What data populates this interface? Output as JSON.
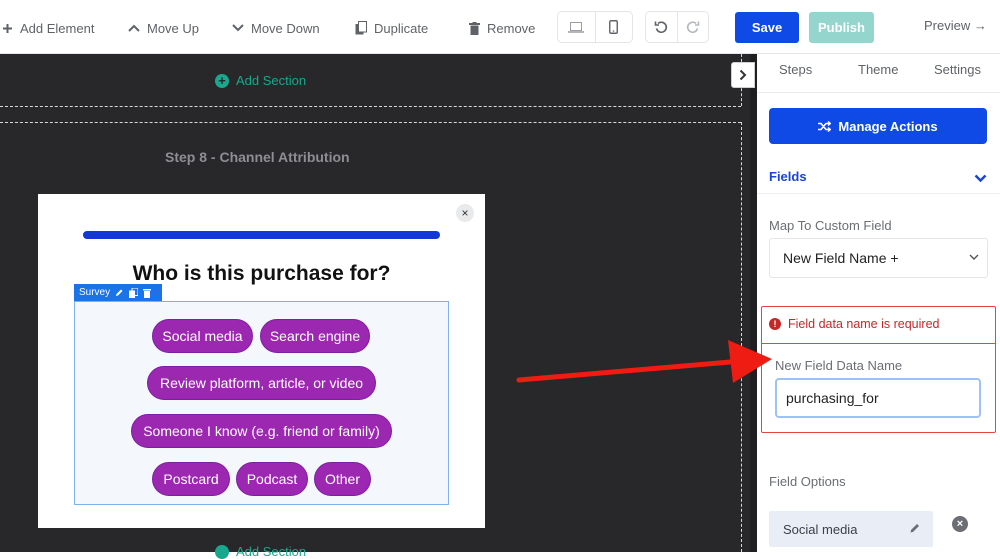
{
  "toolbar": {
    "add_element": "Add Element",
    "move_up": "Move Up",
    "move_down": "Move Down",
    "duplicate": "Duplicate",
    "remove": "Remove",
    "save": "Save",
    "publish": "Publish",
    "preview": "Preview →"
  },
  "canvas": {
    "add_section": "Add Section",
    "step_title": "Step 8 - Channel Attribution",
    "question": "Who is this purchase for?",
    "survey_tag": "Survey",
    "close_glyph": "×",
    "options": [
      "Social media",
      "Search engine",
      "Review platform, article, or video",
      "Someone I know (e.g. friend or family)",
      "Postcard",
      "Podcast",
      "Other"
    ]
  },
  "panel": {
    "tabs": [
      "Steps",
      "Theme",
      "Settings"
    ],
    "manage_actions": "Manage Actions",
    "fields_label": "Fields",
    "map_label": "Map To Custom Field",
    "map_value": "New Field Name +",
    "error_text": "Field data name is required",
    "new_field_label": "New Field Data Name",
    "new_field_value": "purchasing_for",
    "field_options_label": "Field Options",
    "first_option": "Social media"
  },
  "colors": {
    "primary": "#0f4ae6",
    "publish_disabled": "#94d6cd",
    "canvas_bg": "#28272a",
    "accent_green": "#18a88c",
    "chip_purple": "#9c27b0",
    "error_red": "#e1473d",
    "annotation_arrow": "#ee1c12"
  }
}
